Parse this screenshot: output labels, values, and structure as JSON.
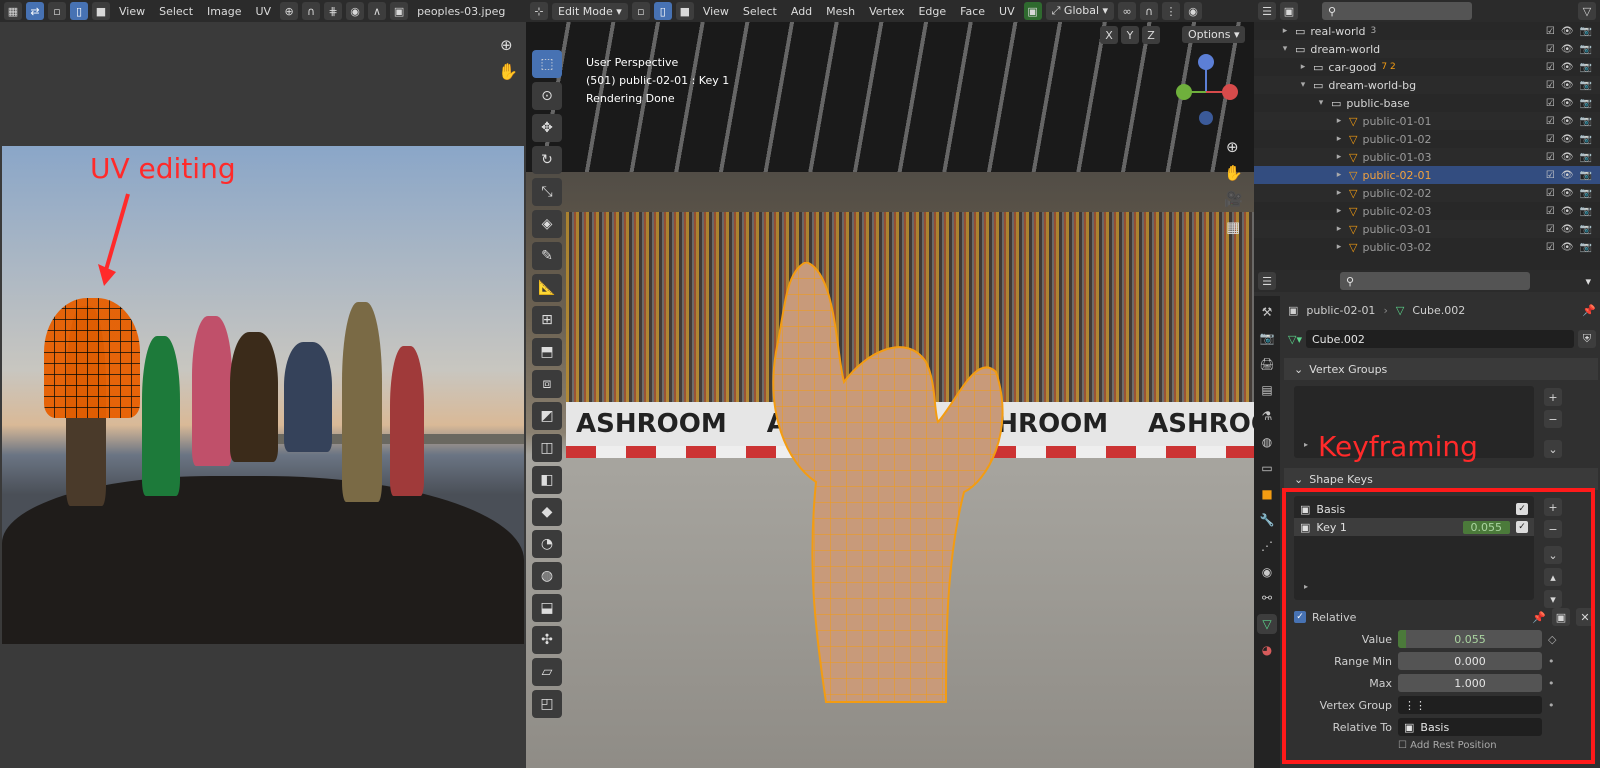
{
  "uv": {
    "menu": [
      "View",
      "Select",
      "Image",
      "UV"
    ],
    "image_name": "peoples-03.jpeg",
    "annotation": "UV editing"
  },
  "viewport": {
    "mode": "Edit Mode",
    "menu": [
      "View",
      "Select",
      "Add",
      "Mesh",
      "Vertex",
      "Edge",
      "Face",
      "UV"
    ],
    "orientation": "Global",
    "axes": [
      "X",
      "Y",
      "Z"
    ],
    "options": "Options",
    "info": [
      "User Perspective",
      "(501) public-02-01 : Key 1",
      "Rendering Done"
    ],
    "banner_word": "ASHROOM"
  },
  "outliner": {
    "rows": [
      {
        "name": "real-world",
        "count": "3",
        "depth": 1,
        "kind": "collection"
      },
      {
        "name": "dream-world",
        "depth": 1,
        "kind": "collection",
        "open": true
      },
      {
        "name": "car-good",
        "depth": 2,
        "kind": "collection",
        "extra": "7 2"
      },
      {
        "name": "dream-world-bg",
        "depth": 2,
        "kind": "collection",
        "open": true
      },
      {
        "name": "public-base",
        "depth": 3,
        "kind": "collection",
        "open": true
      },
      {
        "name": "public-01-01",
        "depth": 4,
        "kind": "object"
      },
      {
        "name": "public-01-02",
        "depth": 4,
        "kind": "object"
      },
      {
        "name": "public-01-03",
        "depth": 4,
        "kind": "object"
      },
      {
        "name": "public-02-01",
        "depth": 4,
        "kind": "object",
        "selected": true
      },
      {
        "name": "public-02-02",
        "depth": 4,
        "kind": "object"
      },
      {
        "name": "public-02-03",
        "depth": 4,
        "kind": "object"
      },
      {
        "name": "public-03-01",
        "depth": 4,
        "kind": "object"
      },
      {
        "name": "public-03-02",
        "depth": 4,
        "kind": "object"
      }
    ]
  },
  "properties": {
    "breadcrumb_object": "public-02-01",
    "breadcrumb_mesh": "Cube.002",
    "mesh_name": "Cube.002",
    "vertex_groups_title": "Vertex Groups",
    "shape_keys_title": "Shape Keys",
    "shape_keys": [
      {
        "name": "Basis",
        "value": ""
      },
      {
        "name": "Key 1",
        "value": "0.055"
      }
    ],
    "relative_label": "Relative",
    "value_label": "Value",
    "value": "0.055",
    "value_fraction": 0.055,
    "range_min_label": "Range Min",
    "range_min": "0.000",
    "max_label": "Max",
    "max": "1.000",
    "vertex_group_label": "Vertex Group",
    "relative_to_label": "Relative To",
    "relative_to": "Basis",
    "add_rest_label": "Add Rest Position",
    "annotation": "Keyframing"
  },
  "colors": {
    "accent": "#4772b3",
    "annotation": "#ff1a1a",
    "selection": "#f39c12"
  }
}
